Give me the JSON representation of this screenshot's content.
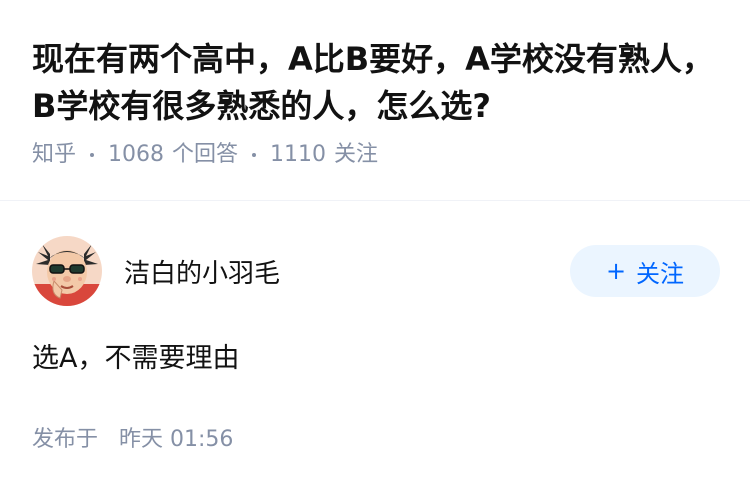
{
  "question": {
    "title": "现在有两个高中，A比B要好，A学校没有熟人，B学校有很多熟悉的人，怎么选?",
    "source": "知乎",
    "answer_count": "1068",
    "answer_label": "个回答",
    "follower_count": "1110",
    "follower_label": "关注"
  },
  "answer": {
    "author": {
      "name": "洁白的小羽毛",
      "avatar_icon": "cartoon-avatar-icon"
    },
    "follow_button": {
      "plus": "+",
      "label": "关注"
    },
    "content": "选A，不需要理由",
    "publish": {
      "prefix": "发布于",
      "time": "昨天 01:56"
    }
  },
  "colors": {
    "title": "#121212",
    "meta": "#8590a6",
    "follow_bg": "#ebf5ff",
    "follow_text": "#0066ff",
    "divider": "#f0f2f7"
  }
}
